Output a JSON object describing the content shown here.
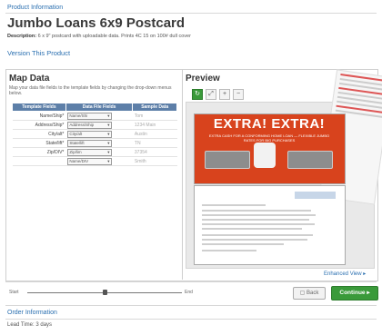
{
  "header": {
    "section_label": "Product Information",
    "title": "Jumbo Loans 6x9 Postcard",
    "description_prefix": "Description:",
    "description_text": "6 x 9\" postcard with uploadable data. Prints 4C 15 on 100# dull cover",
    "version_link": "Version This Product"
  },
  "map_data": {
    "title": "Map Data",
    "subtitle": "Map your data file fields to the template fields by changing the drop-down menus below.",
    "columns": [
      "Template Fields",
      "Data File Fields",
      "Sample Data"
    ],
    "rows": [
      {
        "field": "Name/Ship*",
        "select": "Name/Shi",
        "sample": "Tom"
      },
      {
        "field": "Address/Ship*",
        "select": "Address/Ship",
        "sample": "1234 Main"
      },
      {
        "field": "City/alt*",
        "select": "City/alt",
        "sample": "Austin"
      },
      {
        "field": "State/lift*",
        "select": "State/lift",
        "sample": "TN"
      },
      {
        "field": "Zip/DIV*",
        "select": "Zip/lim",
        "sample": "37354"
      },
      {
        "field": "",
        "select": "Name/DIV",
        "sample": "Smith"
      }
    ]
  },
  "preview": {
    "title": "Preview",
    "tools": [
      "refresh-icon",
      "fullscreen-icon",
      "zoom-in-icon",
      "zoom-out-icon"
    ],
    "front_headline": "EXTRA! EXTRA!",
    "front_subtext": "EXTRA CASH FOR A CONFORMING HOME LOAN — FLEXIBLE JUMBO RATES FOR BIG PURCHASES",
    "enhanced_link": "Enhanced View ▸"
  },
  "footer": {
    "slider_start": "Start",
    "slider_end": "End",
    "back_label": "Back",
    "continue_label": "Continue ▸",
    "order_section": "Order Information",
    "lead_time": "Lead Time: 3 days"
  }
}
